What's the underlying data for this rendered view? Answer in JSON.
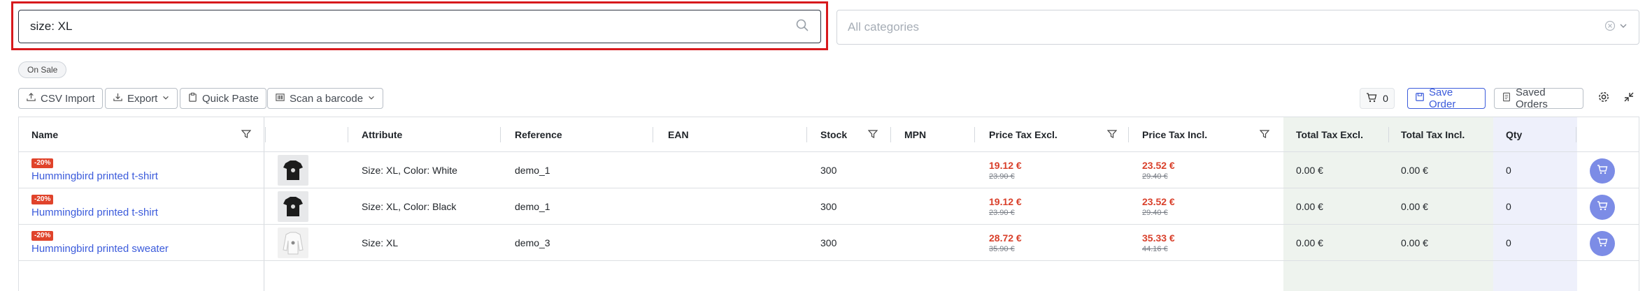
{
  "search": {
    "value": "size: XL"
  },
  "category": {
    "placeholder": "All categories"
  },
  "filters": {
    "on_sale": "On Sale"
  },
  "toolbar": {
    "csv_import": "CSV Import",
    "export": "Export",
    "quick_paste": "Quick Paste",
    "scan_barcode": "Scan a barcode",
    "cart_count": "0",
    "save_order": "Save Order",
    "saved_orders": "Saved Orders"
  },
  "table": {
    "columns": {
      "name": "Name",
      "attribute": "Attribute",
      "reference": "Reference",
      "ean": "EAN",
      "stock": "Stock",
      "mpn": "MPN",
      "price_excl": "Price Tax Excl.",
      "price_incl": "Price Tax Incl.",
      "total_excl": "Total Tax Excl.",
      "total_incl": "Total Tax Incl.",
      "qty": "Qty"
    },
    "rows": [
      {
        "badge": "-20%",
        "name": "Hummingbird printed t-shirt",
        "thumb": "black-tshirt",
        "attribute": "Size: XL, Color: White",
        "reference": "demo_1",
        "ean": "",
        "stock": "300",
        "mpn": "",
        "price_excl": "19.12 €",
        "price_excl_old": "23.90 €",
        "price_incl": "23.52 €",
        "price_incl_old": "29.40 €",
        "total_excl": "0.00 €",
        "total_incl": "0.00 €",
        "qty": "0"
      },
      {
        "badge": "-20%",
        "name": "Hummingbird printed t-shirt",
        "thumb": "black-tshirt",
        "attribute": "Size: XL, Color: Black",
        "reference": "demo_1",
        "ean": "",
        "stock": "300",
        "mpn": "",
        "price_excl": "19.12 €",
        "price_excl_old": "23.90 €",
        "price_incl": "23.52 €",
        "price_incl_old": "29.40 €",
        "total_excl": "0.00 €",
        "total_incl": "0.00 €",
        "qty": "0"
      },
      {
        "badge": "-20%",
        "name": "Hummingbird printed sweater",
        "thumb": "white-sweater",
        "attribute": "Size: XL",
        "reference": "demo_3",
        "ean": "",
        "stock": "300",
        "mpn": "",
        "price_excl": "28.72 €",
        "price_excl_old": "35.90 €",
        "price_incl": "35.33 €",
        "price_incl_old": "44.16 €",
        "total_excl": "0.00 €",
        "total_incl": "0.00 €",
        "qty": "0"
      }
    ]
  },
  "colors": {
    "accent": "#3b5bdb",
    "discount": "#e0432b",
    "cart_button": "#7c8ce6",
    "highlight": "#d7191c",
    "total_column_bg": "#eef3ee",
    "qty_column_bg": "#eef0fb"
  }
}
